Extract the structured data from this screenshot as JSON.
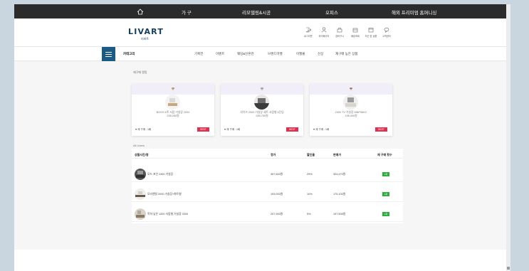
{
  "topbar": {
    "items": [
      "가 구",
      "리모델링&시공",
      "오피스",
      "해외 프리미엄 홈퍼니싱"
    ]
  },
  "header": {
    "logo": "LIVART",
    "logo_sub": "리바트",
    "utils": [
      "로그아웃",
      "마이페이지",
      "장바구니",
      "배송조회",
      "최근 본 상품",
      "고객센터"
    ]
  },
  "nav": {
    "category": "카테고리",
    "items": [
      "기획전",
      "이벤트",
      "웨딩&신혼관",
      "브랜드마켓",
      "이월몰",
      "신상",
      "재구매 높은 상품"
    ]
  },
  "top3": {
    "title": "재구매 랭킹",
    "cards": [
      {
        "name": "BOGS 6주 서랍 거실장 2000",
        "price": "238,260원",
        "rebuy": "♥ 재 구매 : 1회",
        "badge": "BEST"
      },
      {
        "name": "샤이즈 2000 거실장 세트 서랍형 6단입",
        "price": "285,750원",
        "rebuy": "♥ 재 구매 : 1회",
        "badge": "BEST"
      },
      {
        "name": "2400 TV 거실장 MNP06KC",
        "price": "198,400원",
        "rebuy": "♥ 재 구매 : 1회",
        "badge": "BEST"
      }
    ]
  },
  "table": {
    "label": "All Users",
    "headers": [
      "상품사진/명",
      "정가",
      "할인율",
      "판매가",
      "재 구매 횟수"
    ],
    "rows": [
      {
        "name": "모드 포인 2400 거실장",
        "price": "457,600원",
        "discount": "29%",
        "sale": "324,470원",
        "count": "1회"
      },
      {
        "name": "모리엔탈 2000 거실장+화트형",
        "price": "193,000원",
        "discount": "10%",
        "sale": "175,100원",
        "count": "1회"
      },
      {
        "name": "목하 낮은 1200 서랍형 거실장 2000",
        "price": "207,900원",
        "discount": "5%",
        "sale": "197,505원",
        "count": "1회"
      }
    ]
  },
  "colors": {
    "topbar": "#2b2b2b",
    "brand": "#14405f",
    "accent": "#1a5b86",
    "best": "#e0304f",
    "count_badge": "#2fae3f"
  }
}
